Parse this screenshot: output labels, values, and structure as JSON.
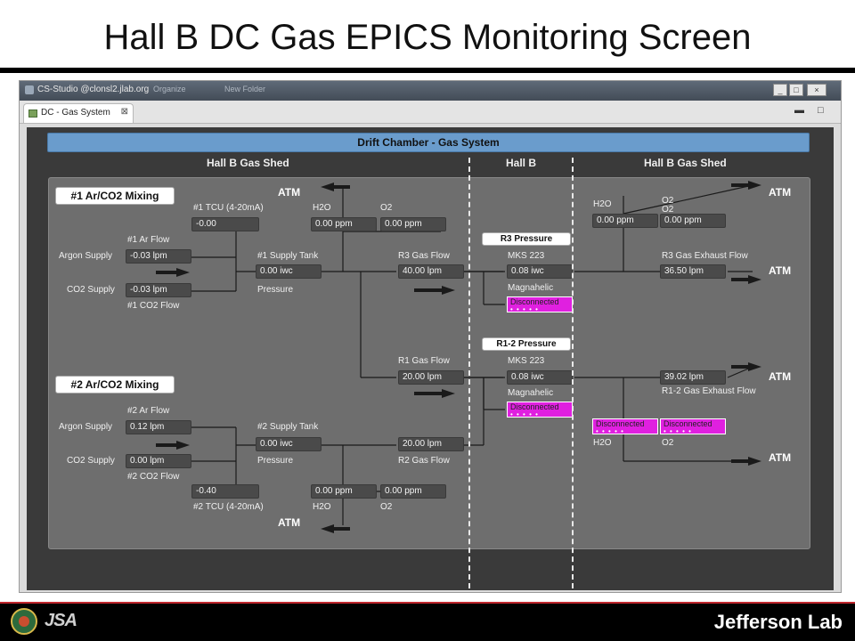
{
  "slide_title": "Hall B DC Gas EPICS Monitoring Screen",
  "app": {
    "window_title": "CS-Studio @clonsl2.jlab.org",
    "menu_items": [
      "Organize",
      "New Folder"
    ],
    "tab_label": "DC - Gas System",
    "win_buttons": [
      "_",
      "□",
      "×"
    ],
    "view_buttons": [
      "▬",
      "□"
    ]
  },
  "screen": {
    "banner": "Drift Chamber - Gas System",
    "section_heads": [
      "Hall B Gas Shed",
      "Hall B",
      "Hall B Gas Shed"
    ],
    "atm_label": "ATM",
    "mix1": {
      "title": "#1 Ar/CO2 Mixing",
      "tcu_label": "#1 TCU (4-20mA)",
      "tcu_value": "-0.00",
      "ar_flow_label": "#1 Ar Flow",
      "argon_supply_label": "Argon Supply",
      "argon_value": "-0.03 lpm",
      "co2_supply_label": "CO2 Supply",
      "co2_value": "-0.03 lpm",
      "co2_flow_label": "#1 CO2 Flow",
      "supply_tank_label": "#1 Supply Tank",
      "supply_tank_value": "0.00 iwc",
      "pressure_label": "Pressure",
      "h2o_label": "H2O",
      "h2o_value": "0.00 ppm",
      "o2_label": "O2",
      "o2_value": "0.00 ppm",
      "gas_flow_label": "R3 Gas Flow",
      "gas_flow_value": "40.00 lpm"
    },
    "mix2": {
      "title": "#2 Ar/CO2 Mixing",
      "ar_flow_label": "#2 Ar Flow",
      "argon_supply_label": "Argon Supply",
      "argon_value": "0.12 lpm",
      "co2_supply_label": "CO2 Supply",
      "co2_value": "0.00 lpm",
      "co2_flow_label": "#2 CO2 Flow",
      "supply_tank_label": "#2 Supply Tank",
      "supply_tank_value": "0.00 iwc",
      "pressure_label": "Pressure",
      "tcu_value": "-0.40",
      "tcu_label": "#2 TCU (4-20mA)",
      "h2o_value": "0.00 ppm",
      "o2_value": "0.00 ppm",
      "h2o_label": "H2O",
      "o2_label": "O2",
      "r1_gas_flow_label": "R1 Gas Flow",
      "r1_gas_flow_value": "20.00 lpm",
      "r2_gas_flow_value": "20.00 lpm",
      "r2_gas_flow_label": "R2 Gas Flow"
    },
    "hallb": {
      "r3_pressure_title": "R3 Pressure",
      "r3_mks_label": "MKS 223",
      "r3_mks_value": "0.08 iwc",
      "r3_magnahelic_label": "Magnahelic",
      "r3_magnahelic_value": "Disconnected",
      "r12_pressure_title": "R1-2 Pressure",
      "r12_mks_label": "MKS 223",
      "r12_mks_value": "0.08 iwc",
      "r12_magnahelic_label": "Magnahelic",
      "r12_magnahelic_value": "Disconnected"
    },
    "exhaust": {
      "h2o_label": "H2O",
      "h2o_value": "0.00 ppm",
      "o2_label": "O2",
      "o2_label_2": "O2",
      "o2_value": "0.00 ppm",
      "r3_exhaust_label": "R3 Gas Exhaust Flow",
      "r3_exhaust_value": "36.50 lpm",
      "r12_exhaust_value": "39.02 lpm",
      "r12_exhaust_label": "R1-2 Gas Exhaust Flow",
      "r12_h2o_value": "Disconnected",
      "r12_o2_value": "Disconnected",
      "r12_h2o_label": "H2O",
      "r12_o2_label": "O2"
    }
  },
  "footer": {
    "jsa_logo": "JSA",
    "jlab_logo": "Jefferson Lab"
  },
  "colors": {
    "banner": "#6a9ccc",
    "panel": "#6e6e6e",
    "disconnected": "#e020e0",
    "footer_rule": "#c0272d"
  }
}
